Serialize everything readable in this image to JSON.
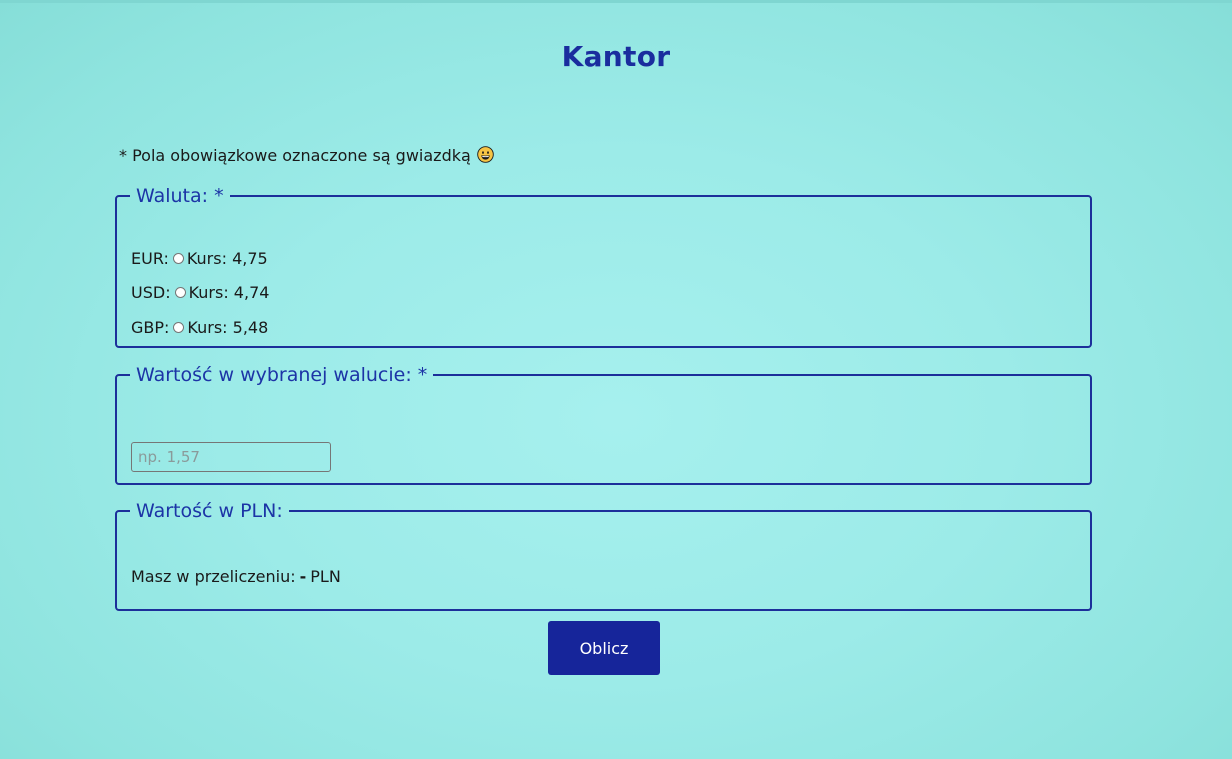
{
  "page": {
    "title": "Kantor",
    "required_note": "* Pola obowiązkowe oznaczone są gwiazdką",
    "note_icon": "grinning-face-emoji"
  },
  "currency_section": {
    "legend": "Waluta: *",
    "options": [
      {
        "code_label": "EUR:",
        "rate_label": "Kurs: 4,75",
        "selected": false
      },
      {
        "code_label": "USD:",
        "rate_label": "Kurs: 4,74",
        "selected": false
      },
      {
        "code_label": "GBP:",
        "rate_label": "Kurs: 5,48",
        "selected": false
      }
    ]
  },
  "amount_section": {
    "legend": "Wartość w wybranej walucie: *",
    "input_value": "",
    "input_placeholder": "np. 1,57"
  },
  "result_section": {
    "legend": "Wartość w PLN:",
    "prefix": "Masz w przeliczeniu:",
    "value": "-",
    "unit": "PLN"
  },
  "actions": {
    "calculate_label": "Oblicz"
  },
  "colors": {
    "accent": "#16259a",
    "legend_text": "#1c34a6",
    "background": "#9cebe8"
  }
}
